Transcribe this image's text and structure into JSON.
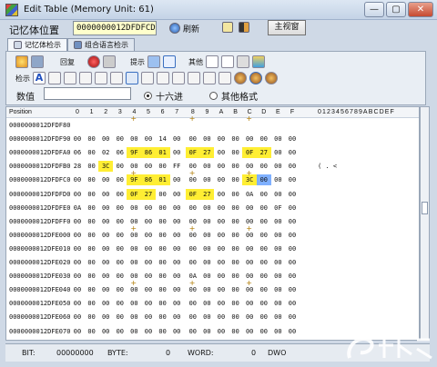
{
  "window": {
    "title": "Edit Table (Memory Unit: 61)",
    "min": "—",
    "max": "▢",
    "close": "✕"
  },
  "address_bar": {
    "label": "记忆体位置",
    "value": "0000000012DFDFCD",
    "refresh_label": "刷新",
    "main_view_button": "主视窗"
  },
  "tabs": [
    {
      "label": "记忆体检示",
      "active": true
    },
    {
      "label": "组合语言检示",
      "active": false
    }
  ],
  "toolbar": {
    "back_label": "回复",
    "hint_label": "提示",
    "other_label": "其他",
    "detect_label": "检示"
  },
  "value_row": {
    "label": "数值",
    "value": "",
    "radio_hex_label": "十六进",
    "radio_other_label": "其他格式",
    "selected": "hex"
  },
  "grid": {
    "header_position": "Position",
    "hex_columns": [
      "0",
      "1",
      "2",
      "3",
      "4",
      "5",
      "6",
      "7",
      "8",
      "9",
      "A",
      "B",
      "C",
      "D",
      "E",
      "F"
    ],
    "ascii_header": "0123456789ABCDEF",
    "rows": [
      {
        "addr": "0000000012DFDF80",
        "cells": [
          "",
          "",
          "",
          "",
          "",
          "",
          "",
          "",
          "",
          "",
          "",
          "",
          "",
          "",
          "",
          ""
        ],
        "ascii": ""
      },
      {
        "addr": "0000000012DFDF90",
        "cells": [
          "00",
          "00",
          "00",
          "00",
          "00",
          "00",
          "14",
          "00",
          "00",
          "00",
          "00",
          "00",
          "00",
          "00",
          "00",
          "00"
        ],
        "ascii": ""
      },
      {
        "addr": "0000000012DFDFA0",
        "cells": [
          "06",
          "00",
          "02",
          "06",
          "9F",
          "86",
          "01",
          "00",
          "0F",
          "27",
          "00",
          "00",
          "0F",
          "27",
          "00",
          "00"
        ],
        "ascii": ""
      },
      {
        "addr": "0000000012DFDFB0",
        "cells": [
          "28",
          "00",
          "3C",
          "00",
          "00",
          "00",
          "00",
          "FF",
          "00",
          "00",
          "00",
          "00",
          "00",
          "00",
          "00",
          "00"
        ],
        "ascii": "( . <"
      },
      {
        "addr": "0000000012DFDFC0",
        "cells": [
          "00",
          "00",
          "00",
          "00",
          "9F",
          "86",
          "01",
          "00",
          "00",
          "00",
          "00",
          "00",
          "3C",
          "00",
          "00",
          "00"
        ],
        "ascii": ""
      },
      {
        "addr": "0000000012DFDFD0",
        "cells": [
          "00",
          "00",
          "00",
          "00",
          "0F",
          "27",
          "00",
          "00",
          "0F",
          "27",
          "00",
          "00",
          "0A",
          "00",
          "00",
          "00"
        ],
        "ascii": ""
      },
      {
        "addr": "0000000012DFDFE0",
        "cells": [
          "0A",
          "00",
          "00",
          "00",
          "00",
          "00",
          "00",
          "00",
          "00",
          "00",
          "00",
          "00",
          "00",
          "00",
          "0F",
          "00"
        ],
        "ascii": ""
      },
      {
        "addr": "0000000012DFDFF0",
        "cells": [
          "00",
          "00",
          "00",
          "00",
          "00",
          "00",
          "00",
          "00",
          "00",
          "00",
          "00",
          "00",
          "00",
          "00",
          "00",
          "00"
        ],
        "ascii": ""
      },
      {
        "addr": "0000000012DFE000",
        "cells": [
          "00",
          "00",
          "00",
          "00",
          "00",
          "00",
          "00",
          "00",
          "00",
          "00",
          "00",
          "00",
          "00",
          "00",
          "00",
          "00"
        ],
        "ascii": ""
      },
      {
        "addr": "0000000012DFE010",
        "cells": [
          "00",
          "00",
          "00",
          "00",
          "00",
          "00",
          "00",
          "00",
          "00",
          "00",
          "00",
          "00",
          "00",
          "00",
          "00",
          "00"
        ],
        "ascii": ""
      },
      {
        "addr": "0000000012DFE020",
        "cells": [
          "00",
          "00",
          "00",
          "00",
          "00",
          "00",
          "00",
          "00",
          "00",
          "00",
          "00",
          "00",
          "00",
          "00",
          "00",
          "00"
        ],
        "ascii": ""
      },
      {
        "addr": "0000000012DFE030",
        "cells": [
          "00",
          "00",
          "00",
          "00",
          "00",
          "00",
          "00",
          "00",
          "0A",
          "00",
          "00",
          "00",
          "00",
          "00",
          "00",
          "00"
        ],
        "ascii": ""
      },
      {
        "addr": "0000000012DFE040",
        "cells": [
          "00",
          "00",
          "00",
          "00",
          "00",
          "00",
          "00",
          "00",
          "00",
          "00",
          "00",
          "00",
          "00",
          "00",
          "00",
          "00"
        ],
        "ascii": ""
      },
      {
        "addr": "0000000012DFE050",
        "cells": [
          "00",
          "00",
          "00",
          "00",
          "00",
          "00",
          "00",
          "00",
          "00",
          "00",
          "00",
          "00",
          "00",
          "00",
          "00",
          "00"
        ],
        "ascii": ""
      },
      {
        "addr": "0000000012DFE060",
        "cells": [
          "00",
          "00",
          "00",
          "00",
          "00",
          "00",
          "00",
          "00",
          "00",
          "00",
          "00",
          "00",
          "00",
          "00",
          "00",
          "00"
        ],
        "ascii": ""
      },
      {
        "addr": "0000000012DFE070",
        "cells": [
          "00",
          "00",
          "00",
          "00",
          "00",
          "00",
          "00",
          "00",
          "00",
          "00",
          "00",
          "00",
          "00",
          "00",
          "00",
          "00"
        ],
        "ascii": ""
      }
    ],
    "highlights": {
      "2": [
        4,
        5,
        6,
        8,
        9,
        12,
        13
      ],
      "3": [
        2
      ],
      "4": [
        4,
        5,
        6,
        12
      ],
      "5": [
        4,
        5,
        8,
        9
      ]
    },
    "selected": {
      "4": [
        13
      ]
    }
  },
  "status": {
    "bit_label": "BIT:",
    "bit_value": "00000000",
    "byte_label": "BYTE:",
    "byte_value": "0",
    "word_label": "WORD:",
    "word_value": "0",
    "dword_label": "DWO"
  },
  "colors": {
    "highlight": "#ffee33",
    "selected": "#7fb0ff"
  }
}
